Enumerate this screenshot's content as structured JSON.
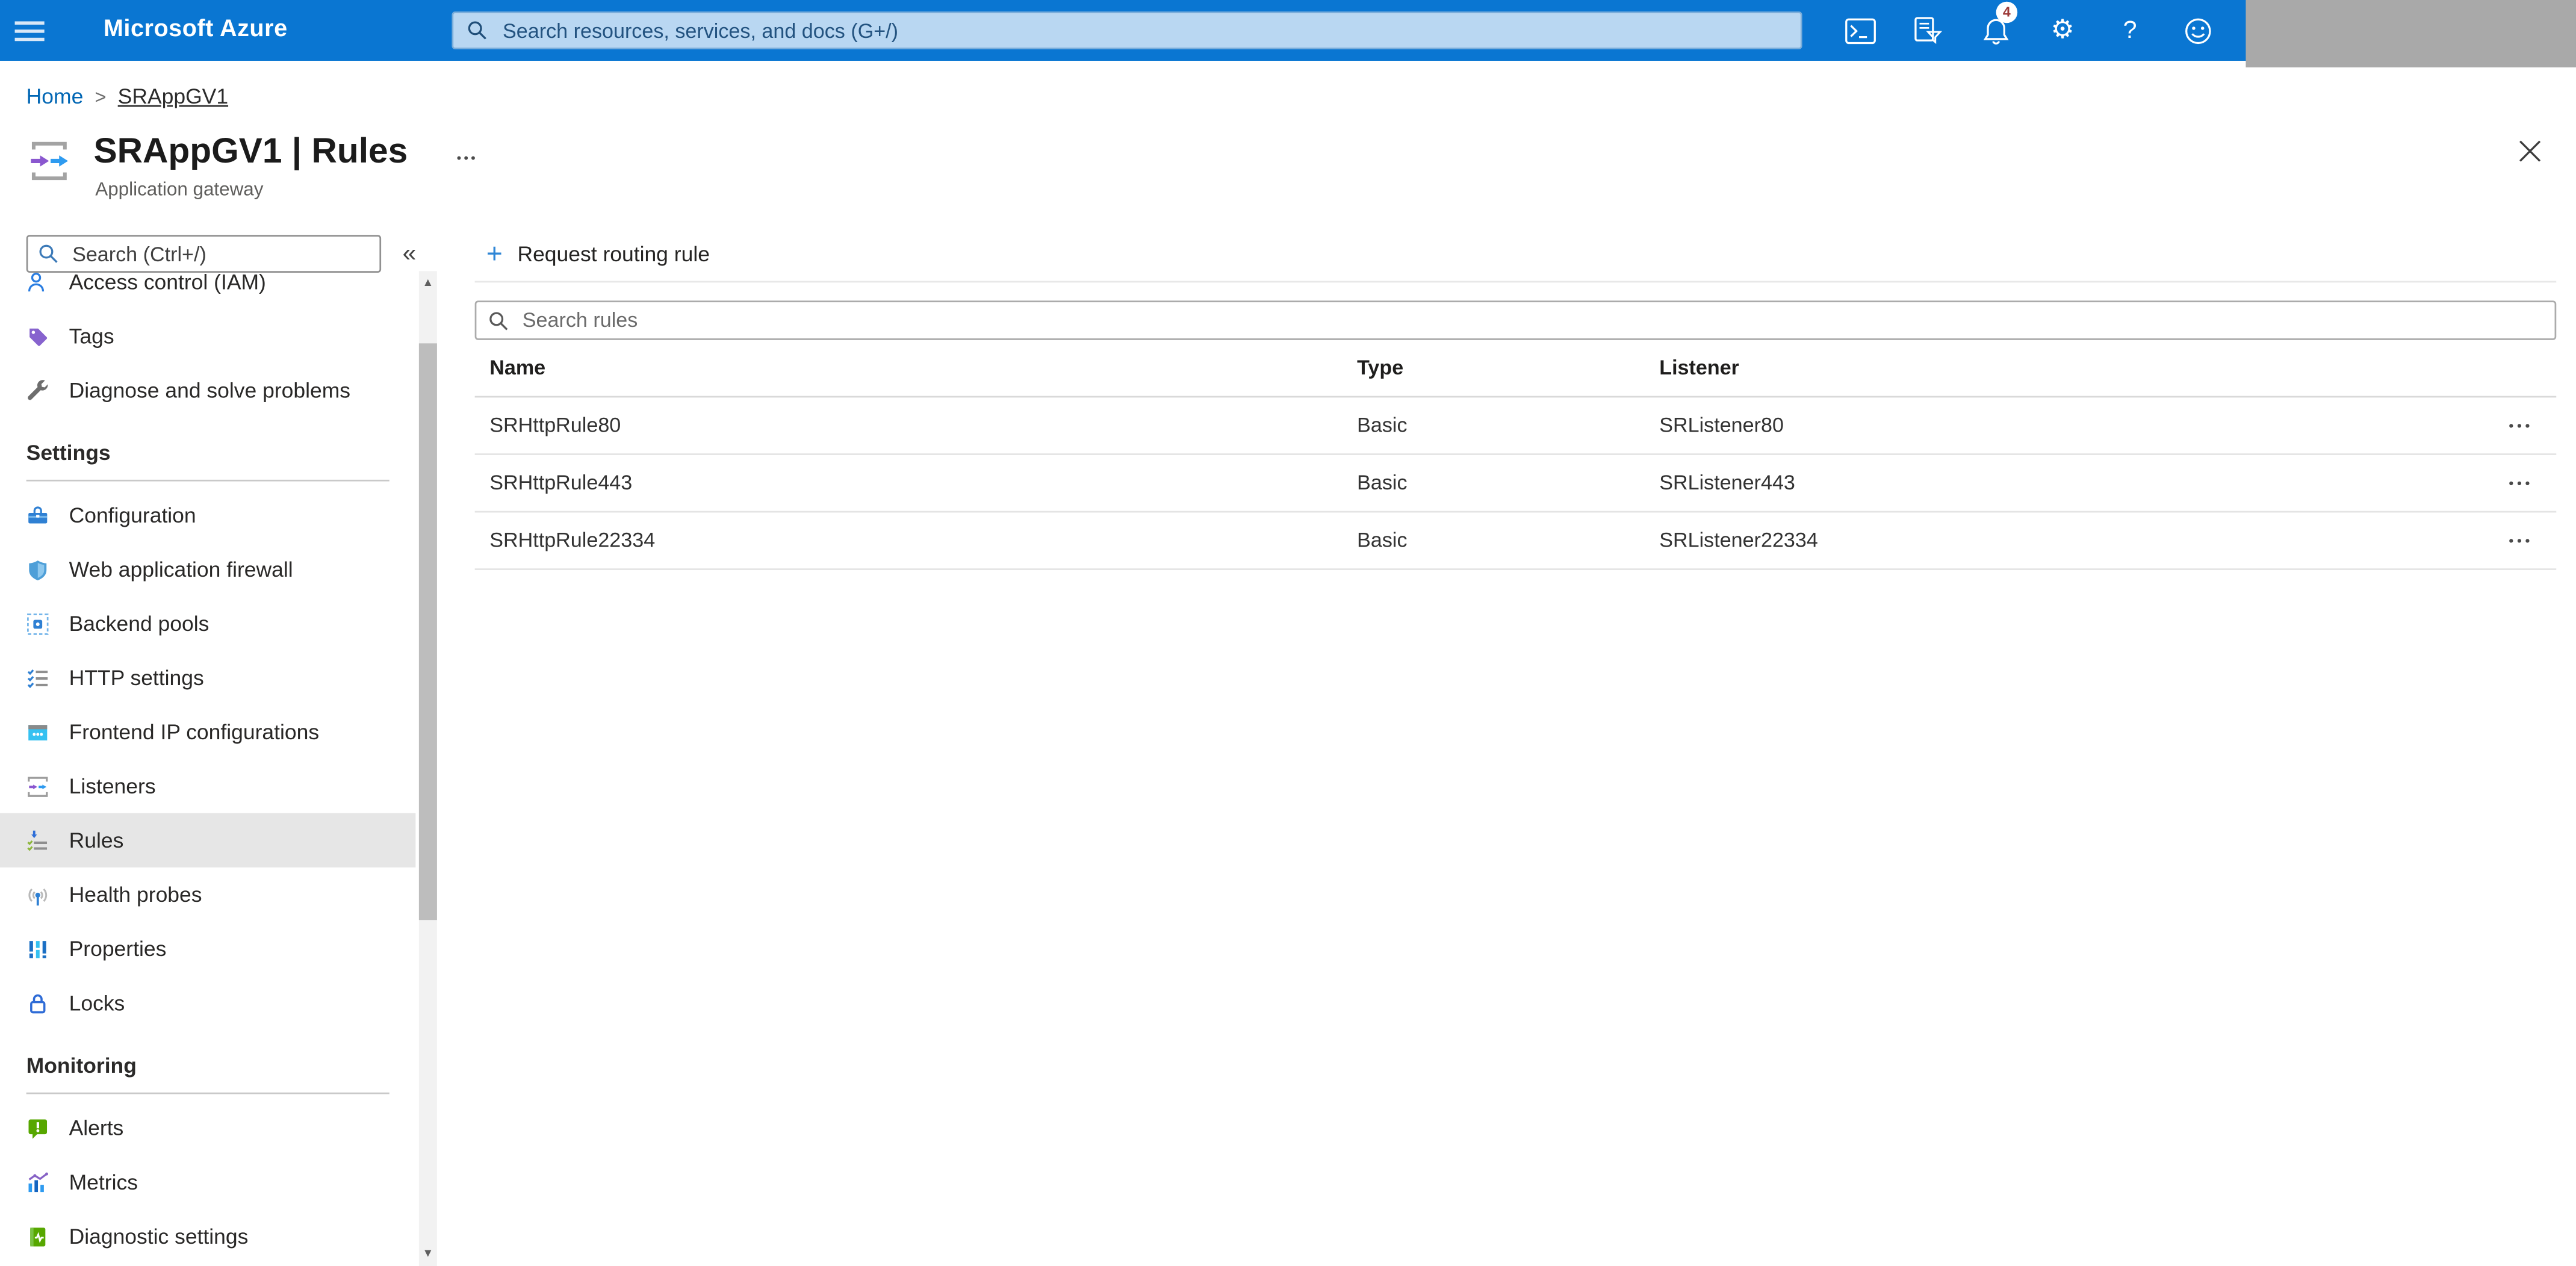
{
  "topbar": {
    "brand": "Microsoft Azure",
    "search_placeholder": "Search resources, services, and docs (G+/)",
    "notification_count": "4",
    "icons": [
      "cloud-shell",
      "directory-filter",
      "notifications-bell",
      "settings-gear",
      "help",
      "feedback-smiley"
    ],
    "help_glyph": "?"
  },
  "breadcrumb": {
    "items": [
      {
        "label": "Home"
      },
      {
        "label": "SRAppGV1"
      }
    ],
    "separator": ">"
  },
  "page": {
    "title": "SRAppGV1 | Rules",
    "subtitle": "Application gateway",
    "more_label": "•••"
  },
  "sidebar": {
    "search_placeholder": "Search (Ctrl+/)",
    "collapse_label": "«",
    "scroll_up_label": "▲",
    "scroll_down_label": "▼",
    "sections": [
      {
        "items": [
          {
            "label": "Access control (IAM)",
            "icon": "access-control-icon"
          },
          {
            "label": "Tags",
            "icon": "tag-icon"
          },
          {
            "label": "Diagnose and solve problems",
            "icon": "wrench-icon"
          }
        ]
      },
      {
        "header": "Settings",
        "items": [
          {
            "label": "Configuration",
            "icon": "toolbox-icon"
          },
          {
            "label": "Web application firewall",
            "icon": "shield-icon"
          },
          {
            "label": "Backend pools",
            "icon": "backend-pools-icon"
          },
          {
            "label": "HTTP settings",
            "icon": "checklist-icon"
          },
          {
            "label": "Frontend IP configurations",
            "icon": "frontend-ip-icon"
          },
          {
            "label": "Listeners",
            "icon": "listeners-icon"
          },
          {
            "label": "Rules",
            "icon": "rules-icon",
            "selected": true
          },
          {
            "label": "Health probes",
            "icon": "health-probes-icon"
          },
          {
            "label": "Properties",
            "icon": "properties-icon"
          },
          {
            "label": "Locks",
            "icon": "lock-icon"
          }
        ]
      },
      {
        "header": "Monitoring",
        "items": [
          {
            "label": "Alerts",
            "icon": "alert-icon"
          },
          {
            "label": "Metrics",
            "icon": "metrics-icon"
          },
          {
            "label": "Diagnostic settings",
            "icon": "diagnostic-settings-icon"
          }
        ]
      }
    ]
  },
  "main": {
    "command_bar": {
      "add_rule_label": "Request routing rule",
      "plus_glyph": "+"
    },
    "search_placeholder": "Search rules",
    "table": {
      "columns": [
        "Name",
        "Type",
        "Listener"
      ],
      "rows": [
        {
          "name": "SRHttpRule80",
          "type": "Basic",
          "listener": "SRListener80"
        },
        {
          "name": "SRHttpRule443",
          "type": "Basic",
          "listener": "SRListener443"
        },
        {
          "name": "SRHttpRule22334",
          "type": "Basic",
          "listener": "SRListener22334"
        }
      ],
      "row_menu_label": "•••"
    }
  },
  "colors": {
    "topbar": "#0a76d2",
    "topbar_search_bg": "#b9d7f2",
    "selected_item_bg": "#e6e6e6",
    "redaction_overlay": "#a9a9a9",
    "breadcrumb_link": "#0066b4",
    "add_icon_blue": "#2f86d6",
    "badge_text": "#9d3a38"
  }
}
